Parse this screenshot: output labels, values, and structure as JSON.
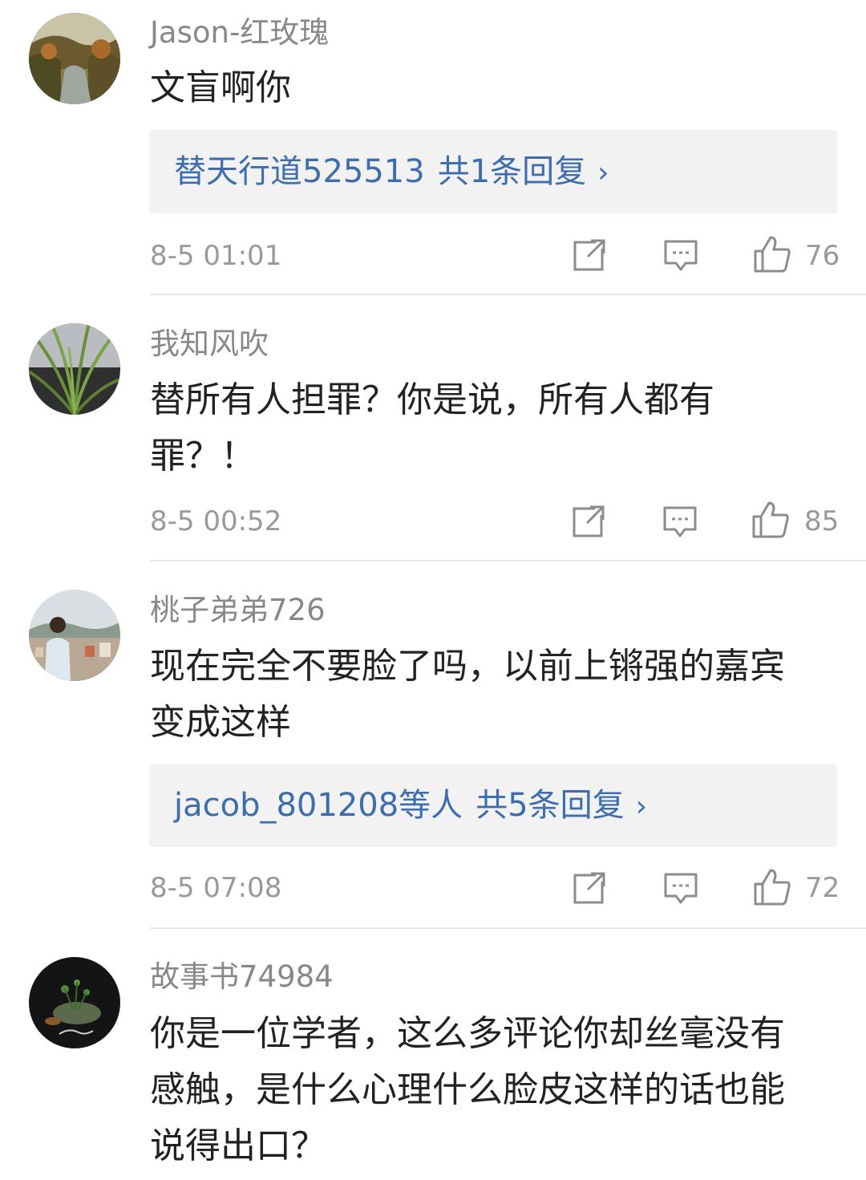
{
  "comments": [
    {
      "username": "Jason-红玫瑰",
      "text": "文盲啊你",
      "reply": {
        "users": "替天行道525513",
        "count_label": "共1条回复",
        "chevron": "›"
      },
      "time": "8-5 01:01",
      "likes": "76"
    },
    {
      "username": "我知风吹",
      "text": "替所有人担罪？你是说，所有人都有罪？！",
      "time": "8-5 00:52",
      "likes": "85"
    },
    {
      "username": "桃子弟弟726",
      "text": "现在完全不要脸了吗，以前上锵强的嘉宾变成这样",
      "reply": {
        "users": "jacob_801208等人",
        "count_label": "共5条回复",
        "chevron": "›"
      },
      "time": "8-5 07:08",
      "likes": "72"
    },
    {
      "username": "故事书74984",
      "text": "你是一位学者，这么多评论你却丝毫没有感触，是什么心理什么脸皮这样的话也能说得出口？"
    }
  ],
  "icons": {
    "share": "share-icon",
    "comment": "comment-icon",
    "like": "thumbs-up-icon"
  },
  "colors": {
    "username": "#888888",
    "reply_link": "#3d6cb0",
    "reply_bg": "#f2f2f2",
    "meta": "#999999"
  }
}
